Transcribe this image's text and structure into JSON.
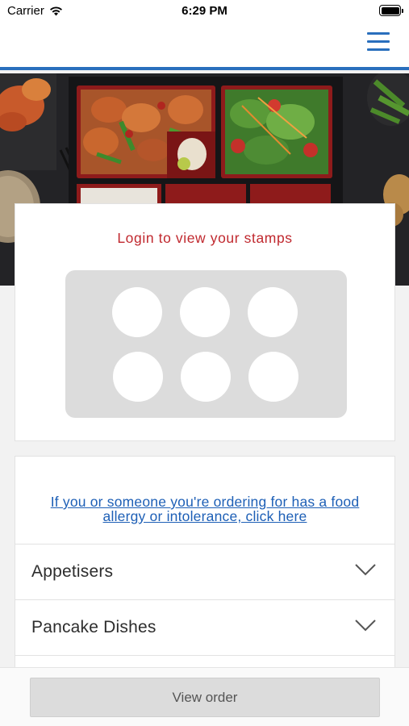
{
  "status_bar": {
    "carrier": "Carrier",
    "time": "6:29 PM",
    "wifi_icon": "wifi-icon",
    "battery_icon": "battery-icon"
  },
  "nav": {
    "menu_icon": "hamburger-menu-icon",
    "accent_color": "#2a6fbd"
  },
  "hero": {
    "image": "bento box food photo with chicken stir-fry, salad, rice and edamame"
  },
  "stamps": {
    "title": "Login to view your stamps",
    "title_color": "#c0282e",
    "count": 6,
    "filled": 0
  },
  "allergy": {
    "link_text": "If you or someone you're ordering for has a food allergy or intolerance, click here",
    "link_color": "#1d5fb6"
  },
  "menu_sections": [
    {
      "label": "Appetisers",
      "icon": "chevron-down-icon"
    },
    {
      "label": "Pancake Dishes",
      "icon": "chevron-down-icon"
    }
  ],
  "footer": {
    "view_order_label": "View order"
  }
}
